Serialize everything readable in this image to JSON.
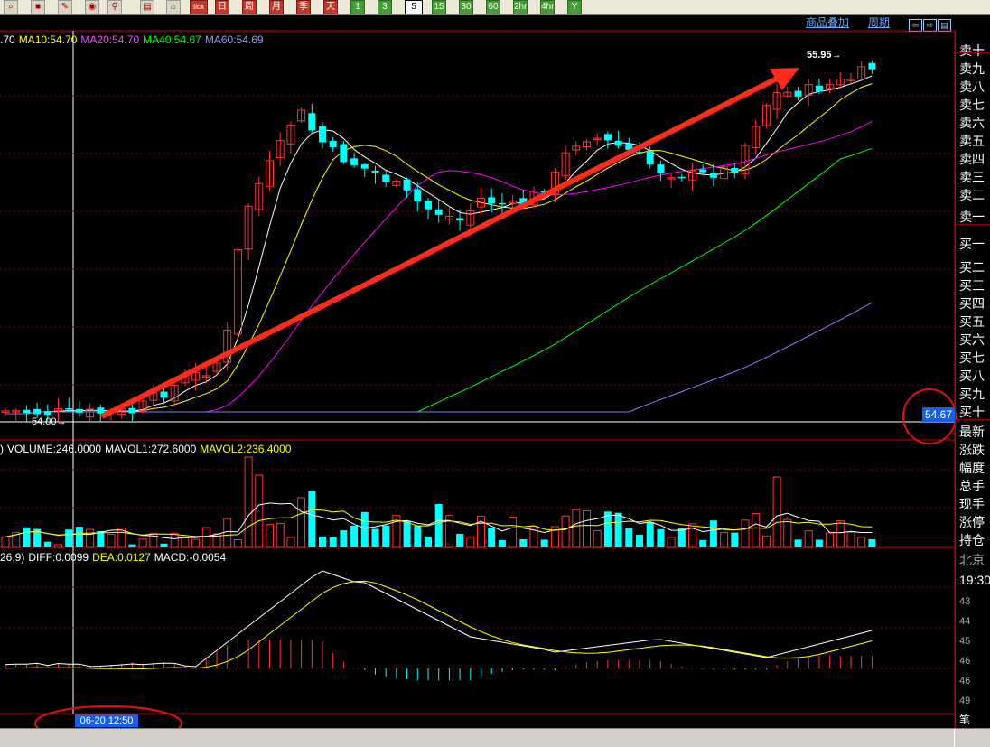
{
  "toolbar": {
    "buttons": [
      {
        "label": "日",
        "style": "red"
      },
      {
        "label": "周",
        "style": "red"
      },
      {
        "label": "月",
        "style": "red"
      },
      {
        "label": "季",
        "style": "red"
      },
      {
        "label": "天",
        "style": "red"
      },
      {
        "label": "1",
        "style": "green"
      },
      {
        "label": "3",
        "style": "green"
      },
      {
        "label": "5",
        "style": "sel"
      },
      {
        "label": "15",
        "style": "green"
      },
      {
        "label": "30",
        "style": "green"
      },
      {
        "label": "60",
        "style": "green"
      },
      {
        "label": "2hr",
        "style": "green"
      },
      {
        "label": "4hr",
        "style": "green"
      },
      {
        "label": "Y",
        "style": "green"
      }
    ],
    "tick_label": "tick"
  },
  "topbar": {
    "overlay_link": "商品叠加",
    "period_link": "周期"
  },
  "main_legend": {
    "ma5": ".70",
    "ma10": "MA10:54.70",
    "ma20": "MA20:54.70",
    "ma40": "MA40:54.67",
    "ma60": "MA60:54.69"
  },
  "vol_legend": {
    "prefix": ")",
    "volume": "VOLUME:246.0000",
    "mavol1": "MAVOL1:272.6000",
    "mavol2": "MAVOL2:236.4000"
  },
  "macd_legend": {
    "prefix": "26,9)",
    "diff": "DIFF:0.0099",
    "dea": "DEA:0.0127",
    "macd": "MACD:-0.0054"
  },
  "annotations": {
    "high_label": "55.95→",
    "low_label": "54.00→",
    "current_price": "54.67",
    "cursor_date": "06-20 12:50"
  },
  "sidebar": {
    "sell": [
      "卖十",
      "卖九",
      "卖八",
      "卖七",
      "卖六",
      "卖五",
      "卖四",
      "卖三",
      "卖二",
      "卖一"
    ],
    "buy": [
      "买一",
      "买二",
      "买三",
      "买四",
      "买五",
      "买六",
      "买七",
      "买八",
      "买九",
      "买十"
    ],
    "info": [
      "最新",
      "涨跌",
      "幅度",
      "总手",
      "现手",
      "涨停",
      "持仓"
    ],
    "city": "北京",
    "time": "19:30",
    "ticks": [
      "43",
      "44",
      "45",
      "46",
      "46",
      "49"
    ],
    "bottom": "笔"
  },
  "colors": {
    "up": "#ff3333",
    "down": "#00ffff",
    "ma5": "#ffffff",
    "ma10": "#ffff00",
    "ma20": "#ff00ff",
    "ma40": "#00ff00",
    "ma60": "#8080ff",
    "grid": "#800000",
    "trend_arrow": "#ff2a1a"
  }
}
